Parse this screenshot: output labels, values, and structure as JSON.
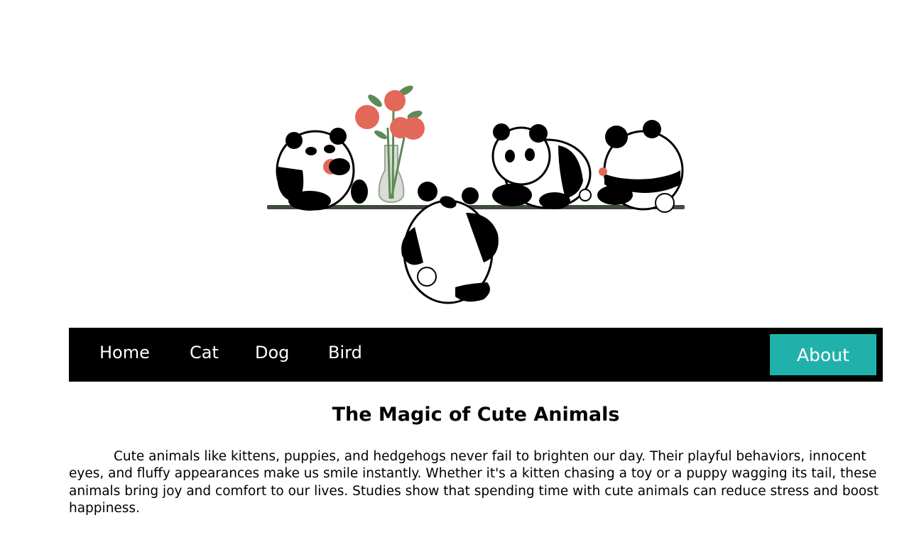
{
  "colors": {
    "nav_background": "#000000",
    "nav_text": "#ffffff",
    "about_button_bg": "#20b2aa",
    "tomato": "#e2695a",
    "leaf": "#5d8a55"
  },
  "hero": {
    "icon": "pandas-on-shelf-illustration"
  },
  "nav": {
    "links": [
      "Home",
      "Cat",
      "Dog",
      "Bird"
    ],
    "about_label": "About"
  },
  "article": {
    "title": "The Magic of Cute Animals",
    "body": "Cute animals like kittens, puppies, and hedgehogs never fail to brighten our day. Their playful behaviors, innocent eyes, and fluffy appearances make us smile instantly. Whether it's a kitten chasing a toy or a puppy wagging its tail, these animals bring joy and comfort to our lives. Studies show that spending time with cute animals can reduce stress and boost happiness."
  }
}
